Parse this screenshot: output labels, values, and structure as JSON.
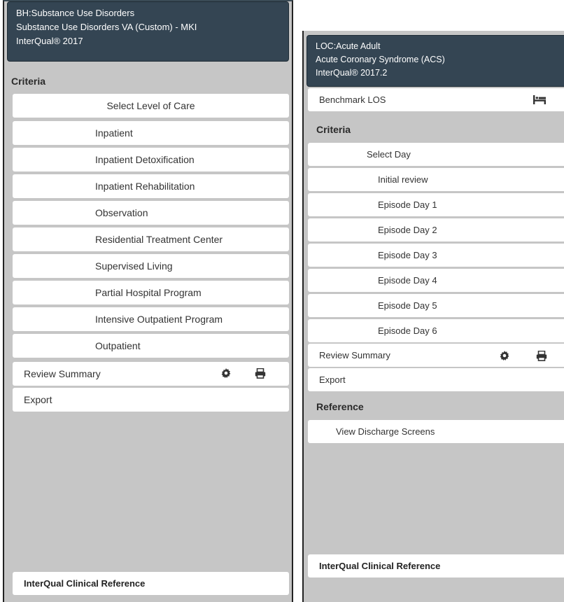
{
  "left": {
    "header": {
      "line1": "BH:Substance Use Disorders",
      "line2": "Substance Use Disorders VA (Custom) - MKI",
      "line3": "InterQual® 2017"
    },
    "criteria_label": "Criteria",
    "select_label": "Select Level of Care",
    "items": [
      "Inpatient",
      "Inpatient Detoxification",
      "Inpatient Rehabilitation",
      "Observation",
      "Residential Treatment Center",
      "Supervised Living",
      "Partial Hospital Program",
      "Intensive Outpatient Program",
      "Outpatient"
    ],
    "review_summary": "Review Summary",
    "export": "Export",
    "clinical_reference": "InterQual Clinical Reference"
  },
  "right": {
    "header": {
      "line1": "LOC:Acute Adult",
      "line2": "Acute Coronary Syndrome (ACS)",
      "line3": "InterQual® 2017.2"
    },
    "benchmark_los": "Benchmark LOS",
    "criteria_label": "Criteria",
    "select_label": "Select Day",
    "items": [
      "Initial review",
      "Episode Day 1",
      "Episode Day 2",
      "Episode Day 3",
      "Episode Day 4",
      "Episode Day 5",
      "Episode Day 6"
    ],
    "review_summary": "Review Summary",
    "export": "Export",
    "reference_label": "Reference",
    "view_discharge": "View Discharge Screens",
    "clinical_reference": "InterQual Clinical Reference"
  },
  "icons": {
    "gear": "gear-icon",
    "print": "print-icon",
    "bed": "bed-icon"
  }
}
